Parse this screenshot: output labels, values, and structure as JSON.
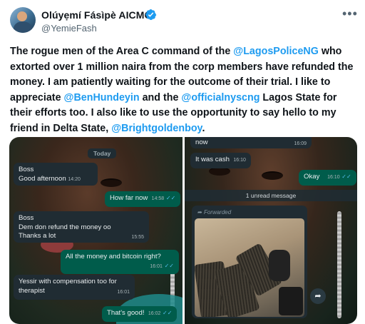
{
  "author": {
    "name": "Olúyẹmí Fásìpè AICMC",
    "handle": "@YemieFash"
  },
  "tweet": {
    "segments": [
      {
        "type": "text",
        "text": "The rogue men of the Area C command of the "
      },
      {
        "type": "mention",
        "text": "@LagosPoliceNG"
      },
      {
        "type": "text",
        "text": " who extorted over 1 million naira from the corp members have refunded the money. I am patiently waiting for the outcome of their trial. I like to appreciate "
      },
      {
        "type": "mention",
        "text": "@BenHundeyin"
      },
      {
        "type": "text",
        "text": " and the "
      },
      {
        "type": "mention",
        "text": "@officialnyscng"
      },
      {
        "type": "text",
        "text": " Lagos State for their efforts too. I also like to use the opportunity to say hello to my friend in Delta State, "
      },
      {
        "type": "mention",
        "text": "@Brightgoldenboy"
      },
      {
        "type": "text",
        "text": "."
      }
    ]
  },
  "chat_left": {
    "date_label": "Today",
    "messages": [
      {
        "dir": "in",
        "lines": [
          "Boss",
          "Good afternoon"
        ],
        "time": "14:20"
      },
      {
        "dir": "out",
        "lines": [
          "How far now"
        ],
        "time": "14:58"
      },
      {
        "dir": "in",
        "lines": [
          "Boss",
          "Dem don refund the money oo",
          "Thanks a lot"
        ],
        "time": "15:55"
      },
      {
        "dir": "out",
        "lines": [
          "All the money and bitcoin right?"
        ],
        "time": "16:01"
      },
      {
        "dir": "in",
        "lines": [
          "Yessir with compensation too for",
          "therapist"
        ],
        "time": "16:01"
      },
      {
        "dir": "out",
        "lines": [
          "That's good!"
        ],
        "time": "16:02"
      }
    ]
  },
  "chat_right": {
    "messages": [
      {
        "dir": "in",
        "lines": [
          "now"
        ],
        "time": "16:09"
      },
      {
        "dir": "in",
        "lines": [
          "It was cash"
        ],
        "time": "16:10"
      },
      {
        "dir": "out",
        "lines": [
          "Okay"
        ],
        "time": "16:10"
      }
    ],
    "unread_label": "1 unread message",
    "forwarded_label": "Forwarded"
  },
  "icons": {
    "verified": "verified-badge-icon",
    "more": "more-options-icon",
    "share": "share-arrow-icon",
    "read_ticks": "double-check-icon"
  },
  "colors": {
    "mention": "#1d9bf0",
    "verified": "#1d9bf0",
    "incoming_bubble": "#202c33",
    "outgoing_bubble": "#005c4b",
    "read_ticks": "#53bdeb"
  }
}
